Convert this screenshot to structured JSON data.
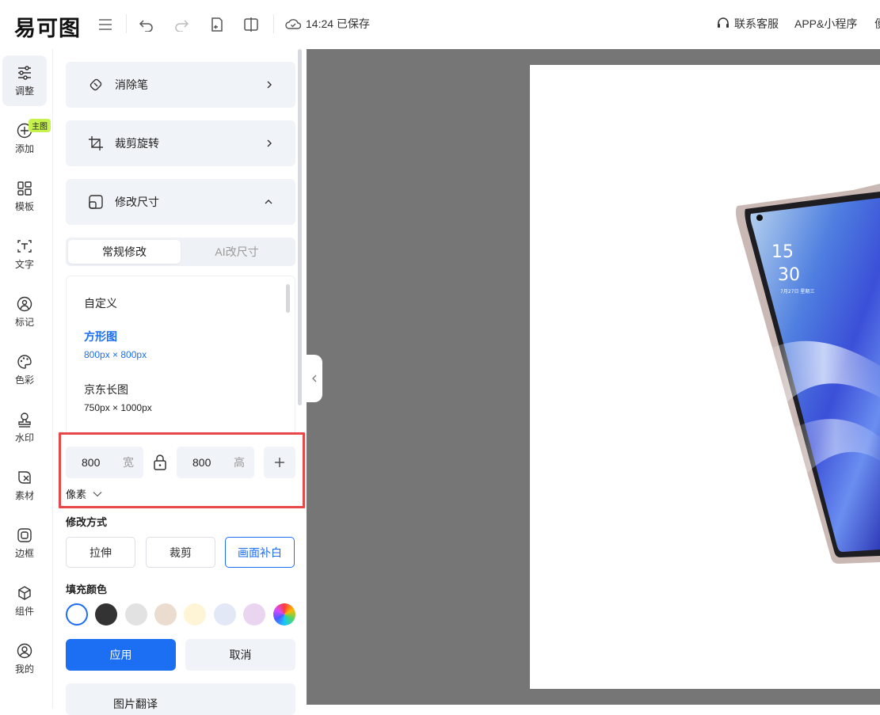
{
  "header": {
    "logo": "易可图",
    "save_time": "14:24 已保存",
    "contact": "联系客服",
    "app": "APP&小程序",
    "cut_text": "便"
  },
  "nav": {
    "items": [
      {
        "label": "调整",
        "icon": "sliders-icon"
      },
      {
        "label": "添加",
        "icon": "plus-circle-icon"
      },
      {
        "label": "模板",
        "icon": "grid-icon"
      },
      {
        "label": "文字",
        "icon": "text-icon"
      },
      {
        "label": "标记",
        "icon": "mark-icon"
      },
      {
        "label": "色彩",
        "icon": "palette-icon"
      },
      {
        "label": "水印",
        "icon": "stamp-icon"
      },
      {
        "label": "素材",
        "icon": "material-icon"
      },
      {
        "label": "边框",
        "icon": "frame-icon"
      },
      {
        "label": "组件",
        "icon": "cube-icon"
      },
      {
        "label": "我的",
        "icon": "user-icon"
      }
    ],
    "badge": "主图"
  },
  "panel": {
    "cards": {
      "eraser": "消除笔",
      "crop": "裁剪旋转",
      "resize": "修改尺寸"
    },
    "tabs": {
      "normal": "常规修改",
      "ai": "AI改尺寸"
    },
    "presets": [
      {
        "name": "自定义",
        "size": ""
      },
      {
        "name": "方形图",
        "size": "800px × 800px"
      },
      {
        "name": "京东长图",
        "size": "750px × 1000px"
      }
    ],
    "width": {
      "value": "800",
      "unit": "宽"
    },
    "height": {
      "value": "800",
      "unit": "高"
    },
    "unit_select": "像素",
    "mode_label": "修改方式",
    "modes": [
      "拉伸",
      "裁剪",
      "画面补白"
    ],
    "fill_label": "填充颜色",
    "swatches": [
      "#ffffff",
      "#333333",
      "#e2e2e2",
      "#eadccf",
      "#fdf5d6",
      "#e3e8f6",
      "#ead5f1"
    ],
    "apply": "应用",
    "cancel": "取消",
    "bottom_card": "图片翻译"
  },
  "canvas": {
    "clock_hour": "15",
    "clock_min": "30",
    "date": "7月27日 星期三"
  }
}
